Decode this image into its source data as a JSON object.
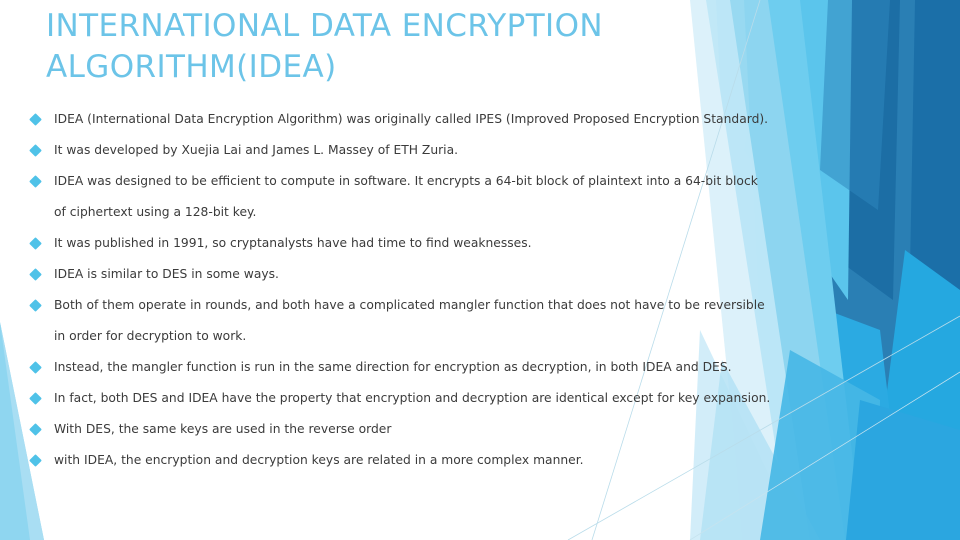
{
  "slide": {
    "title": "INTERNATIONAL DATA ENCRYPTION ALGORITHM(IDEA)",
    "title_color": "#6CC4E8",
    "body_text_color": "#3B3B3B",
    "background_color": "#FFFFFF",
    "bullet_glyph": "diamond",
    "bullet_color": "#4FC2E8",
    "bullets": [
      {
        "line1": "IDEA (International Data Encryption Algorithm) was originally called IPES (Improved Proposed Encryption Standard).",
        "line2": ""
      },
      {
        "line1": "It was developed by Xuejia Lai and James L.  Massey of ETH Zuria.",
        "line2": ""
      },
      {
        "line1": "IDEA was designed to be efficient to compute in software. It encrypts a 64-bit block of plaintext into a 64-bit block",
        "line2": "of ciphertext using a 128-bit key."
      },
      {
        "line1": "It was published in 1991, so cryptanalysts have had time to find weaknesses.",
        "line2": ""
      },
      {
        "line1": "IDEA is similar to DES in some ways.",
        "line2": ""
      },
      {
        "line1": "Both of them operate in rounds, and both have a complicated mangler function that does not have to be reversible",
        "line2": "in order for decryption to work."
      },
      {
        "line1": "Instead, the mangler function is run in the same direction for encryption as decryption,  in both IDEA and DES.",
        "line2": ""
      },
      {
        "line1": "In fact,  both DES and IDEA have the property that encryption and decryption are identical except for key expansion.",
        "line2": ""
      },
      {
        "line1": "With DES, the same keys are used in the reverse order",
        "line2": ""
      },
      {
        "line1": "with IDEA, the encryption and decryption keys are related in a more complex manner.",
        "line2": ""
      }
    ],
    "decoration": {
      "name": "facet-polygon-graphic",
      "palette": [
        "#1B6FA8",
        "#2E86BE",
        "#2BA8DC",
        "#29ABE2",
        "#5BC5EC",
        "#8FD6F0",
        "#BEE7F7",
        "#DCF1FA",
        "#EFF9FD"
      ]
    }
  }
}
